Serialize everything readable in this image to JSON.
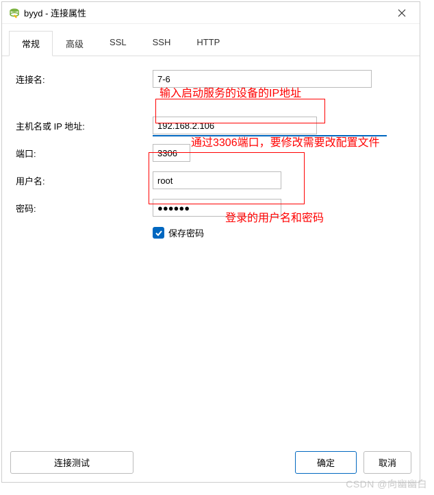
{
  "window": {
    "title": "byyd - 连接属性"
  },
  "tabs": {
    "general": "常规",
    "advanced": "高级",
    "ssl": "SSL",
    "ssh": "SSH",
    "http": "HTTP"
  },
  "labels": {
    "connection_name": "连接名:",
    "host": "主机名或 IP 地址:",
    "port": "端口:",
    "username": "用户名:",
    "password": "密码:",
    "save_password": "保存密码"
  },
  "values": {
    "connection_name": "7-6",
    "host": "192.168.2.106",
    "port": "3306",
    "username": "root",
    "password": "●●●●●●"
  },
  "annotations": {
    "ip_hint": "输入启动服务的设备的IP地址",
    "port_hint": "通过3306端口，要修改需要改配置文件",
    "login_hint": "登录的用户名和密码"
  },
  "buttons": {
    "test": "连接测试",
    "ok": "确定",
    "cancel": "取消"
  },
  "watermark": "CSDN @向幽幽白"
}
